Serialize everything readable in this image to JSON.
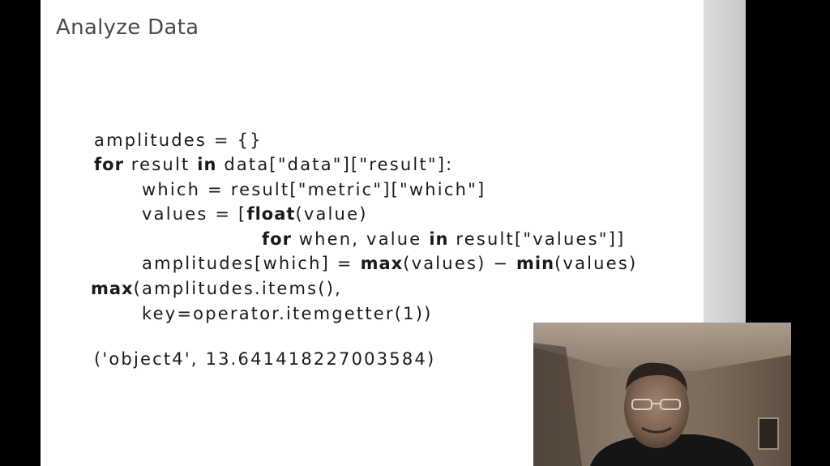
{
  "slide": {
    "title": "Analyze Data",
    "code": {
      "line1": "amplitudes = {}",
      "line2_kw": "for",
      "line2_a": " result ",
      "line2_kw2": "in",
      "line2_b": " data[\"data\"][\"result\"]:",
      "line3": "which = result[\"metric\"][\"which\"]",
      "line4_a": "values = [",
      "line4_kw": "float",
      "line4_b": "(value)",
      "line5_kw": "for",
      "line5_a": " when, value ",
      "line5_kw2": "in",
      "line5_b": " result[\"values\"]]",
      "line6_a": "amplitudes[which] = ",
      "line6_kw": "max",
      "line6_b": "(values) − ",
      "line6_kw2": "min",
      "line6_c": "(values)",
      "line7_kw": "max",
      "line7_a": "(amplitudes.items(),",
      "line8": "key=operator.itemgetter(1))",
      "output": "('object4', 13.641418227003584)"
    }
  },
  "webcam": {
    "content": "presenter video"
  }
}
